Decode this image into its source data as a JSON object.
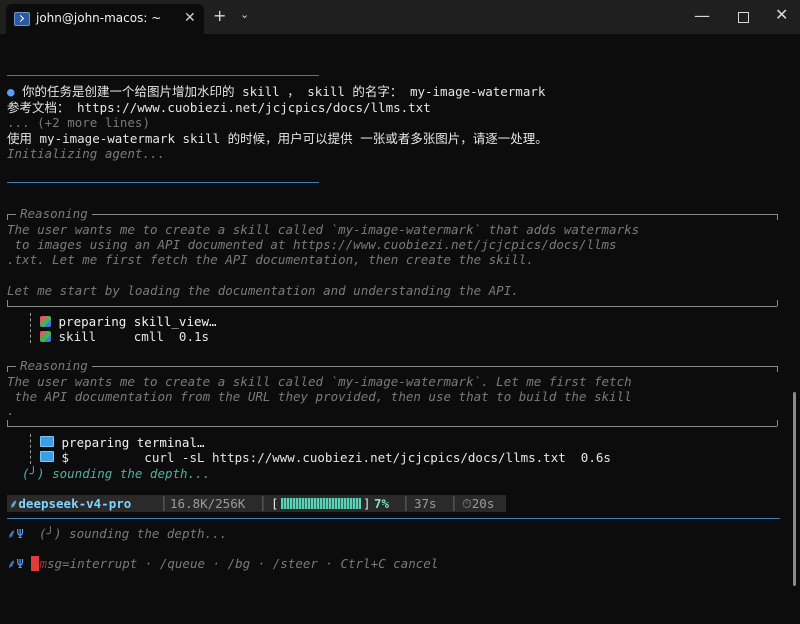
{
  "titlebar": {
    "tab_title": "john@john-macos: ~",
    "tab_close": "✕",
    "new_tab": "+",
    "dropdown": "⌄",
    "minimize": "—",
    "close": "✕"
  },
  "prompt": {
    "bullet": "●",
    "line1": " 你的任务是创建一个给图片增加水印的 skill ， skill 的名字： my-image-watermark",
    "line2": "参考文档： https://www.cuobiezi.net/jcjcpics/docs/llms.txt",
    "line3": "... (+2 more lines)",
    "line4": "使用 my-image-watermark skill 的时候，用户可以提供 一张或者多张图片，请逐一处理。",
    "line5": "Initializing agent..."
  },
  "reasoning1": {
    "label": "Reasoning",
    "lines": [
      "The user wants me to create a skill called `my-image-watermark` that adds watermarks",
      " to images using an API documented at https://www.cuobiezi.net/jcjcpics/docs/llms",
      ".txt. Let me first fetch the API documentation, then create the skill.",
      "",
      "Let me start by loading the documentation and understanding the API."
    ]
  },
  "tool1": {
    "line1": " preparing skill_view…",
    "line2": " skill     cmll  0.1s"
  },
  "reasoning2": {
    "label": "Reasoning",
    "lines": [
      "The user wants me to create a skill called `my-image-watermark`. Let me first fetch",
      " the API documentation from the URL they provided, then use that to build the skill",
      "."
    ]
  },
  "tool2": {
    "line1": " preparing terminal…",
    "line2": " $          curl -sL https://www.cuobiezi.net/jcjcpics/docs/llms.txt  0.6s",
    "line3": "(╯) sounding the depth..."
  },
  "status": {
    "model": "deepseek-v4-pro",
    "tokens": "16.8K/256K",
    "percent": "7%",
    "elapsed": "37s",
    "timer": "20s",
    "progress": 0.07
  },
  "footer": {
    "thinking": "(╯) sounding the depth...",
    "hint_rest": "sg=interrupt · /queue · /bg · /steer · Ctrl+C cancel",
    "hint_first": "m",
    "glyph": "⸙Ψ"
  },
  "colors": {
    "accent": "#3b7ec0",
    "bullet": "#5a9cff",
    "cursor": "#e23b3b",
    "progress": "#5fd0b5"
  }
}
